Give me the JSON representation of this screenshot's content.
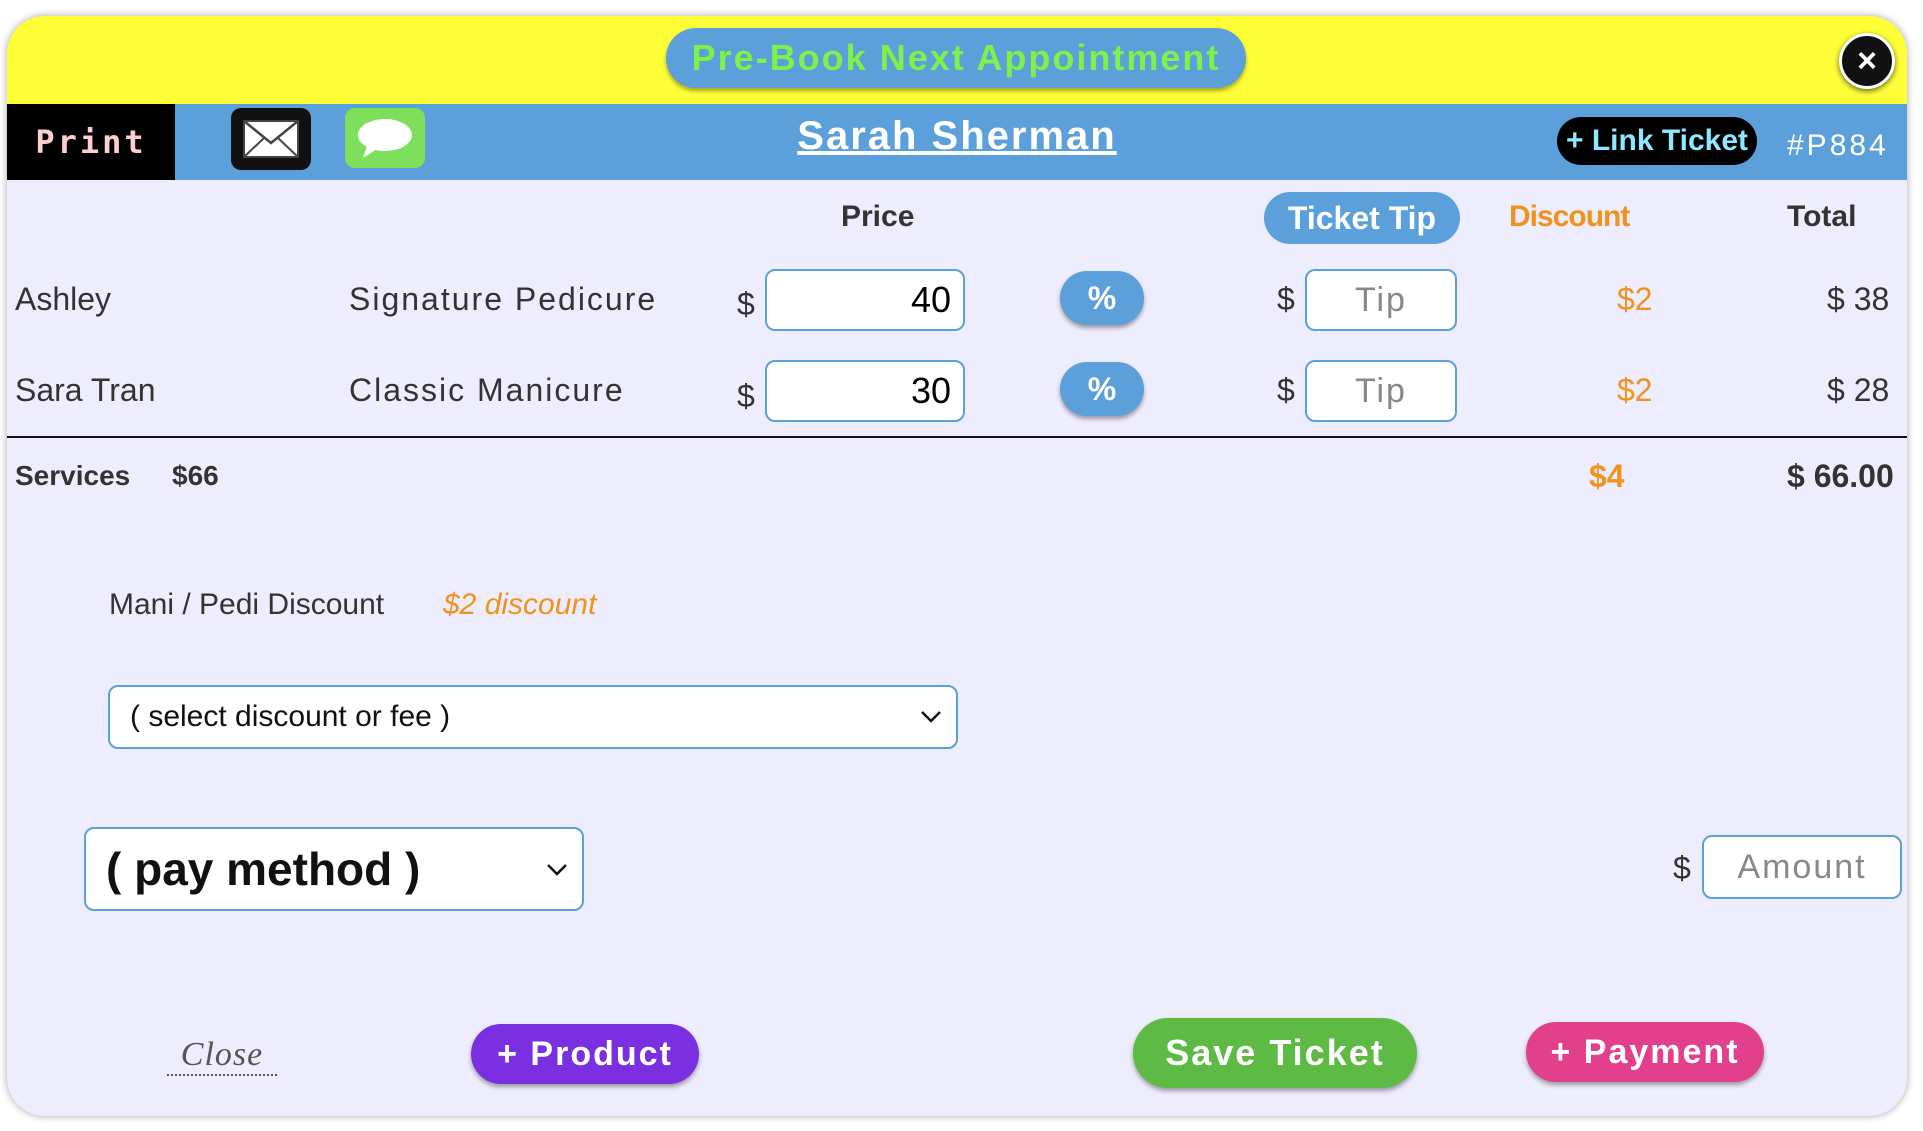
{
  "header": {
    "prebook_label": "Pre-Book Next Appointment",
    "close_symbol": "×",
    "print_label": "Print",
    "client_name": "Sarah Sherman",
    "link_ticket_label": "+ Link Ticket",
    "ticket_number": "#P884"
  },
  "columns": {
    "price": "Price",
    "ticket_tip": "Ticket Tip",
    "discount": "Discount",
    "total": "Total"
  },
  "rows": [
    {
      "staff": "Ashley",
      "service": "Signature Pedicure",
      "currency": "$",
      "price": "40",
      "pct": "%",
      "tip_currency": "$",
      "tip_placeholder": "Tip",
      "discount": "$2",
      "total": "$ 38"
    },
    {
      "staff": "Sara Tran",
      "service": "Classic Manicure",
      "currency": "$",
      "price": "30",
      "pct": "%",
      "tip_currency": "$",
      "tip_placeholder": "Tip",
      "discount": "$2",
      "total": "$ 28"
    }
  ],
  "summary": {
    "label": "Services",
    "subtotal": "$66",
    "discount": "$4",
    "total": "$ 66.00"
  },
  "promo": {
    "name": "Mani / Pedi Discount",
    "value": "$2 discount"
  },
  "discount_select": {
    "selected": "( select discount or fee )"
  },
  "payment": {
    "method_selected": "( pay method )",
    "currency": "$",
    "amount_placeholder": "Amount"
  },
  "footer": {
    "close_label": "Close",
    "product_label": "+ Product",
    "save_label": "Save Ticket",
    "payment_label": "+ Payment"
  },
  "colors": {
    "top_bar": "#ffff38",
    "blue_bar": "#5b9fdb",
    "discount_orange": "#f0921b",
    "product_purple": "#7a2fe0",
    "save_green": "#5cba45",
    "payment_pink": "#e23f8c"
  },
  "icons": [
    "close-icon",
    "mail-icon",
    "message-icon",
    "chevron-down-icon"
  ]
}
